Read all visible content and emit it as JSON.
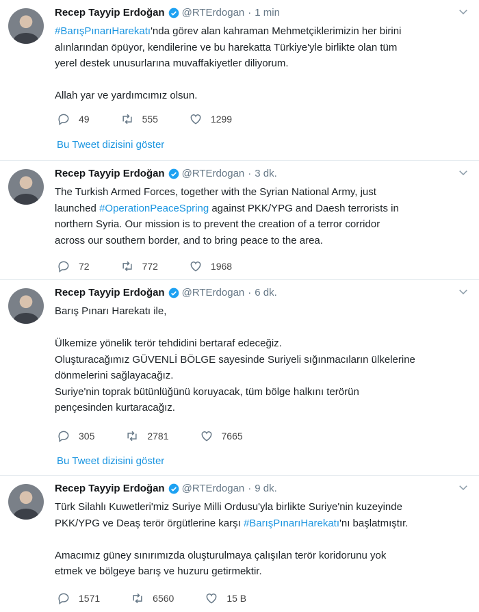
{
  "tweets": [
    {
      "name": "Recep Tayyip Erdoğan",
      "handle": "@RTErdogan",
      "sep": "·",
      "time": "1 min",
      "p1_hashtag": "#BarışPınarıHarekatı",
      "p1_rest_a": "'nda görev alan kahraman Mehmetçiklerimizin her birini",
      "p1_line2": "alınlarından öpüyor, kendilerine ve bu harekatta Türkiye'yle birlikte olan tüm",
      "p1_line3": "yerel destek unusurlarına muvaffakiyetler diliyorum.",
      "p2": "Allah yar ve yardımcımız olsun.",
      "replies": "49",
      "retweets": "555",
      "likes": "1299",
      "show_thread": "Bu Tweet dizisini göster"
    },
    {
      "name": "Recep Tayyip Erdoğan",
      "handle": "@RTErdogan",
      "sep": "·",
      "time": "3 dk.",
      "l1": "The Turkish Armed Forces, together with the Syrian National Army, just",
      "l2a": "launched ",
      "l2_hashtag": "#OperationPeaceSpring",
      "l2b": " against PKK/YPG and Daesh terrorists in",
      "l3": "northern Syria. Our mission is to prevent the creation of a terror corridor",
      "l4": "across our southern border, and to bring peace to the area.",
      "replies": "72",
      "retweets": "772",
      "likes": "1968"
    },
    {
      "name": "Recep Tayyip Erdoğan",
      "handle": "@RTErdogan",
      "sep": "·",
      "time": "6 dk.",
      "l1": "Barış Pınarı Harekatı ile,",
      "l2": "Ülkemize yönelik terör tehdidini bertaraf edeceğiz.",
      "l3": "Oluşturacağımız GÜVENLİ BÖLGE sayesinde Suriyeli sığınmacıların ülkelerine",
      "l4": "dönmelerini sağlayacağız.",
      "l5": "Suriye'nin toprak bütünlüğünü koruyacak, tüm bölge halkını terörün",
      "l6": "pençesinden kurtaracağız.",
      "replies": "305",
      "retweets": "2781",
      "likes": "7665",
      "show_thread": "Bu Tweet dizisini göster"
    },
    {
      "name": "Recep Tayyip Erdoğan",
      "handle": "@RTErdogan",
      "sep": "·",
      "time": "9 dk.",
      "l1": "Türk Silahlı Kuwetleri'miz Suriye Milli Ordusu'yla birlikte Suriye'nin kuzeyinde",
      "l2a": "PKK/YPG ve Deaş terör örgütlerine karşı ",
      "l2_hashtag": "#BarışPınarıHarekatı",
      "l2b": "'nı başlatmıştır.",
      "l3": "Amacımız güney sınırımızda oluşturulmaya çalışılan terör koridorunu yok",
      "l4": "etmek ve bölgeye barış ve huzuru getirmektir.",
      "replies": "1571",
      "retweets": "6560",
      "likes": "15 B"
    }
  ],
  "colors": {
    "link": "#1b95e0",
    "verified": "#1da1f2",
    "secondary": "#657786"
  }
}
